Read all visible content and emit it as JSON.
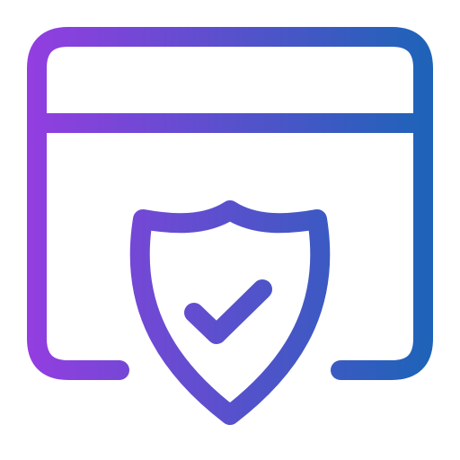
{
  "icon": {
    "name": "secure-browser-shield-icon",
    "gradient": {
      "start": "#9B3BE3",
      "end": "#1566B5"
    },
    "background": "#ffffff"
  }
}
